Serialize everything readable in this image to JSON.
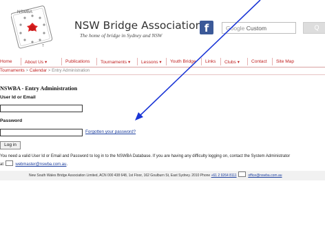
{
  "header": {
    "logo_text": "NSWBA",
    "title": "NSW Bridge Association",
    "tagline": "The home of bridge in Sydney and NSW",
    "fb_glyph": "f",
    "search": {
      "brand": "Google",
      "placeholder": "Custom",
      "button_glyph": "Q"
    }
  },
  "nav": {
    "items": [
      {
        "label": "Home"
      },
      {
        "label": "About Us ▾"
      },
      {
        "label": "Publications"
      },
      {
        "label": "Tournaments ▾"
      },
      {
        "label": "Lessons ▾"
      },
      {
        "label": "Youth Bridge"
      },
      {
        "label": "Links"
      },
      {
        "label": "Clubs ▾"
      },
      {
        "label": "Contact"
      },
      {
        "label": "Site Map"
      }
    ]
  },
  "breadcrumb": {
    "items": [
      "Tournaments",
      "Calendar",
      "Entry Administration"
    ],
    "separator": ">"
  },
  "main": {
    "heading": "NSWBA - Entry Administration",
    "user_label": "User Id or Email",
    "user_value": "",
    "password_label": "Password",
    "password_value": "",
    "forgot_link": "Forgotten your password?",
    "login_button": "Log in",
    "help_text": "You need a valid User Id or Email and Password to log in to the NSWBA Database. If you are having any difficulty logging on, contact the System Administrator",
    "help_at": "at",
    "help_email": "webmaster@nswba.com.au",
    "help_end": "."
  },
  "footer": {
    "text": "New South Wales Bridge Association Limited, ACN 000 438 648, 1st Floor, 162 Goulburn St, East Sydney. 2010 Phone",
    "phone": "+61 2 9264 8111",
    "email": "office@nswba.com.au"
  },
  "colors": {
    "nav_text": "#c02020",
    "link": "#1a3d9e",
    "annotation_arrow": "#1a35d6",
    "facebook": "#3b5998"
  }
}
